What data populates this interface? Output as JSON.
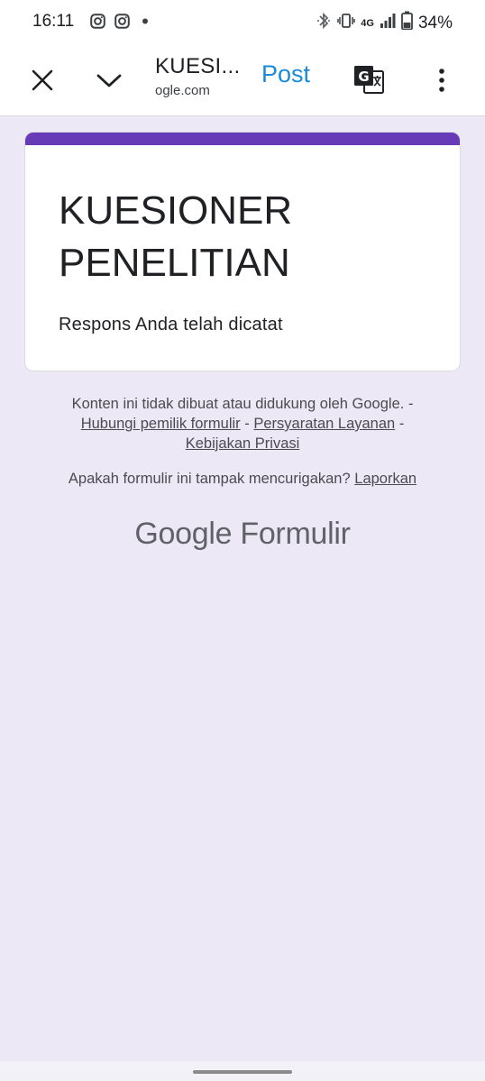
{
  "status_bar": {
    "time": "16:11",
    "notification_icons": [
      "instagram-icon",
      "instagram-icon",
      "dot-icon"
    ],
    "battery": "34%",
    "network": "4G"
  },
  "app_bar": {
    "title": "KUESI...",
    "url": "ogle.com",
    "post_label": "Post",
    "post_color": "#1a8bd8"
  },
  "form": {
    "accent_color": "#673ab7",
    "title": "KUESIONER PENELITIAN",
    "confirmation": "Respons Anda telah dicatat"
  },
  "footer": {
    "disclaimer": "Konten ini tidak dibuat atau didukung oleh Google.",
    "separator": "-",
    "links": {
      "contact_owner": "Hubungi pemilik formulir",
      "terms": "Persyaratan Layanan",
      "privacy": "Kebijakan Privasi"
    },
    "report_question": "Apakah formulir ini tampak mencurigakan?",
    "report_link": "Laporkan",
    "brand_google": "Google",
    "brand_product": "Formulir"
  }
}
